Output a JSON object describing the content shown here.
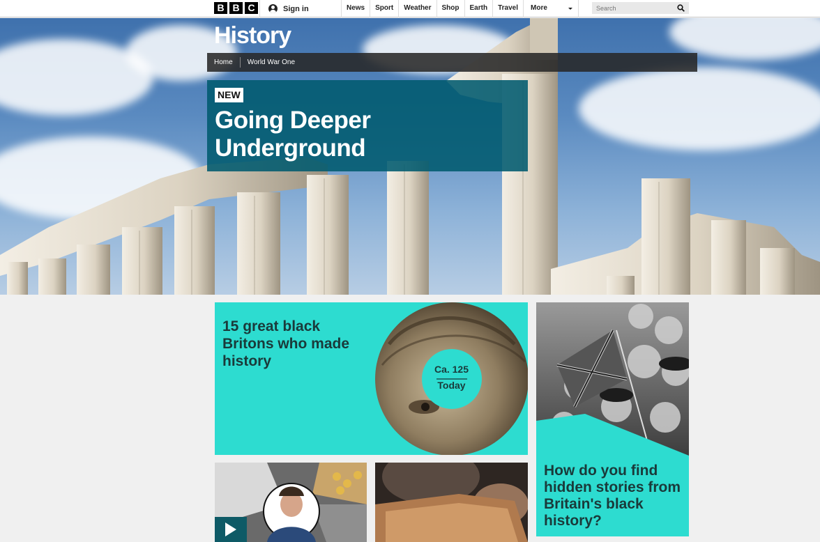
{
  "brand": {
    "letters": [
      "B",
      "B",
      "C"
    ]
  },
  "header": {
    "signin_label": "Sign in",
    "nav": [
      "News",
      "Sport",
      "Weather",
      "Shop",
      "Earth",
      "Travel"
    ],
    "more_label": "More",
    "search_placeholder": "Search"
  },
  "hero": {
    "site_title": "History",
    "breadcrumb": [
      "Home",
      "World War One"
    ],
    "feature": {
      "badge": "NEW",
      "title": "Going Deeper Underground"
    }
  },
  "cards": {
    "black_britons": {
      "title": "15 great black Britons who made history",
      "date_from": "Ca. 125",
      "date_to": "Today"
    },
    "hidden_stories": {
      "title": "How do you find hidden stories from Britain's black history?"
    }
  },
  "colors": {
    "accent": "#2ddcd0",
    "feature_bg": "#005a6e",
    "text_dark": "#1a3a3a"
  }
}
